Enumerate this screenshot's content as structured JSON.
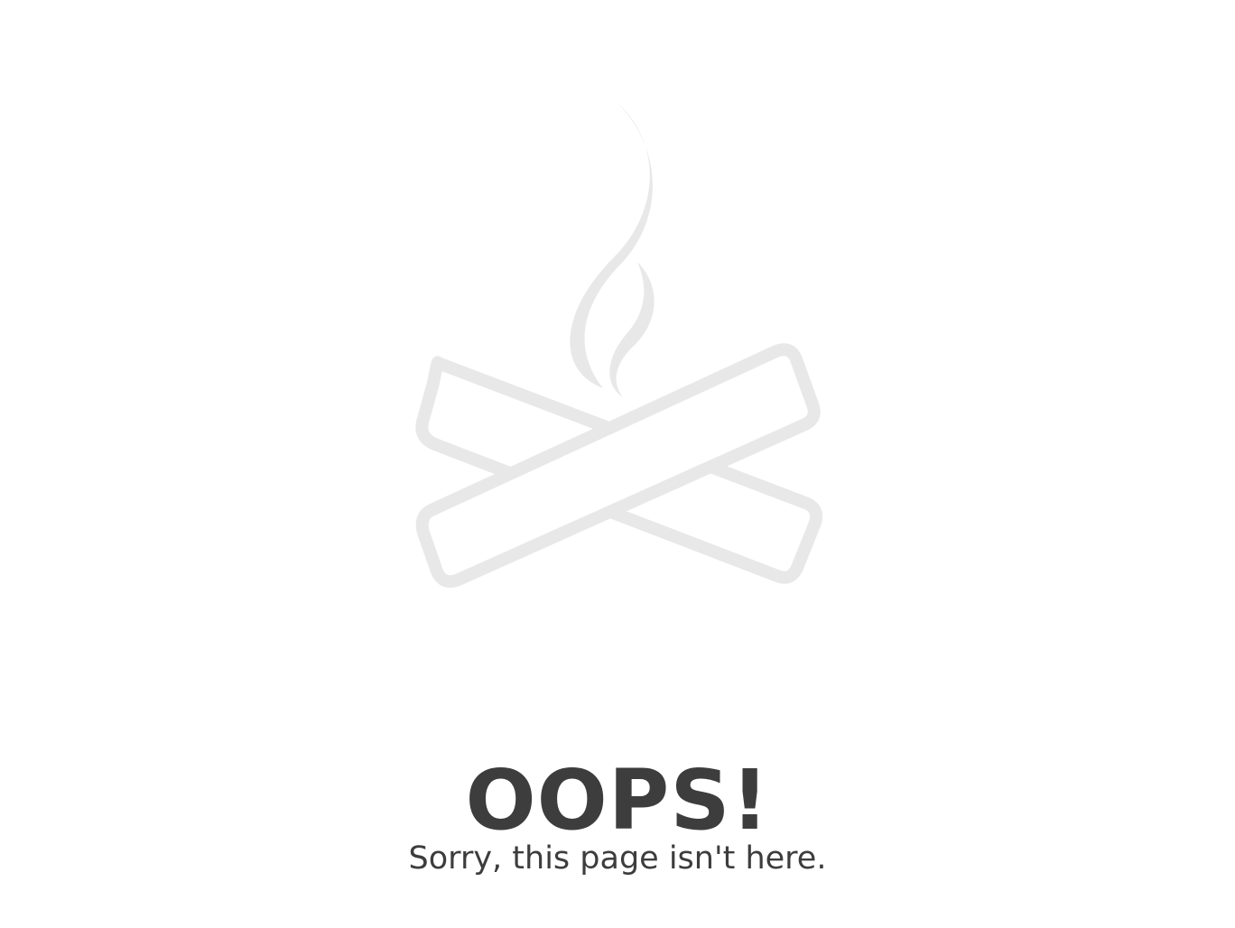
{
  "illustration": {
    "icon": "campfire-smoke-icon",
    "color": "#e8e8e8"
  },
  "error": {
    "title": "OOPS!",
    "message": "Sorry, this page isn't here."
  },
  "colors": {
    "background": "#ffffff",
    "text": "#3d3d3d"
  }
}
